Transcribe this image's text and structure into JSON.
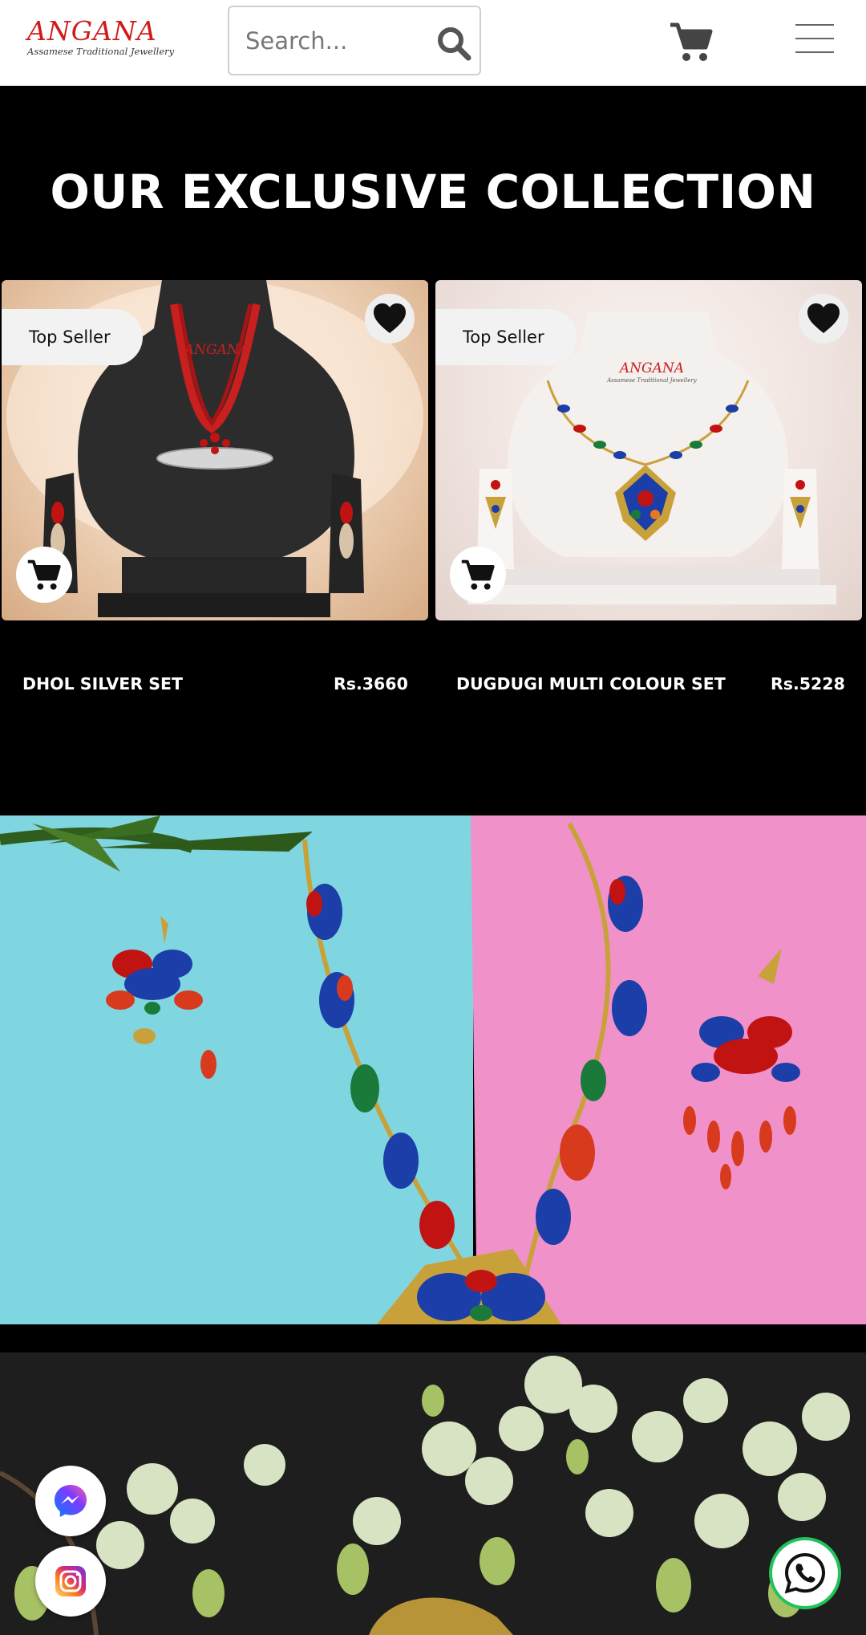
{
  "header": {
    "logo_text": "ANGANA",
    "logo_tagline": "Assamese Traditional Jewellery",
    "search_placeholder": "Search...",
    "icons": [
      "search-icon",
      "cart-icon",
      "hamburger-menu-icon"
    ]
  },
  "collection": {
    "title": "OUR EXCLUSIVE COLLECTION",
    "products": [
      {
        "badge": "Top Seller",
        "name": "DHOL SILVER SET",
        "price": "Rs.3660",
        "image_watermark": "ANGANA"
      },
      {
        "badge": "Top Seller",
        "name": "DUGDUGI MULTI COLOUR SET",
        "price": "Rs.5228",
        "image_watermark": "ANGANA",
        "image_watermark_sub": "Assamese Traditional Jewellery"
      }
    ]
  },
  "floating": {
    "icons": [
      "messenger-icon",
      "instagram-icon",
      "whatsapp-icon"
    ]
  },
  "colors": {
    "brand_red": "#d01b1b",
    "whatsapp_green": "#22c25c",
    "banner_cyan": "#7fd6e0",
    "banner_pink": "#f191c9"
  }
}
